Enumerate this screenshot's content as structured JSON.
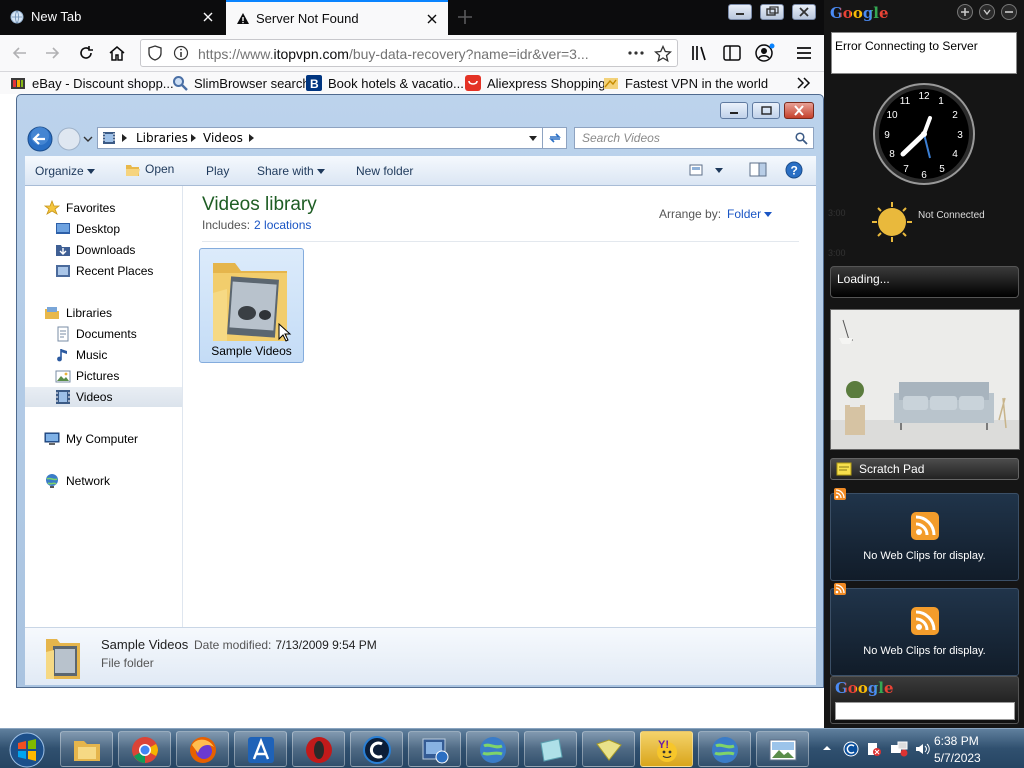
{
  "browser": {
    "tabs": [
      {
        "label": "New Tab",
        "active": false
      },
      {
        "label": "Server Not Found",
        "active": true
      }
    ],
    "url_prefix": "https://www.",
    "url_domain": "itopvpn.com",
    "url_path": "/buy-data-recovery?name=idr&ver=3...",
    "bookmarks": [
      {
        "label": "eBay - Discount shopp...",
        "icon": "ebay-icon"
      },
      {
        "label": "SlimBrowser search",
        "icon": "search-icon"
      },
      {
        "label": "Book hotels & vacatio...",
        "icon": "booking-icon"
      },
      {
        "label": "Aliexpress Shopping",
        "icon": "aliexpress-icon"
      },
      {
        "label": "Fastest VPN in the world",
        "icon": "vpn-icon"
      }
    ]
  },
  "explorer": {
    "breadcrumb": [
      "Libraries",
      "Videos"
    ],
    "search_placeholder": "Search Videos",
    "toolbar": {
      "organize": "Organize",
      "open": "Open",
      "play": "Play",
      "share_with": "Share with",
      "new_folder": "New folder"
    },
    "nav": {
      "favorites": "Favorites",
      "desktop": "Desktop",
      "downloads": "Downloads",
      "recent_places": "Recent Places",
      "libraries": "Libraries",
      "documents": "Documents",
      "music": "Music",
      "pictures": "Pictures",
      "videos": "Videos",
      "my_computer": "My Computer",
      "network": "Network"
    },
    "library_title": "Videos library",
    "includes_label": "Includes:",
    "includes_link": "2 locations",
    "arrange_label": "Arrange by:",
    "arrange_value": "Folder",
    "folder_name": "Sample Videos",
    "details": {
      "name": "Sample Videos",
      "modified_label": "Date modified:",
      "modified_value": "7/13/2009 9:54 PM",
      "type": "File folder"
    }
  },
  "sidebar": {
    "logo": "Google",
    "error_text": "Error Connecting to Server",
    "weather_status": "Not Connected",
    "ghost_times": [
      "3:00",
      "3:00"
    ],
    "loading_text": "Loading...",
    "scratch_pad": "Scratch Pad",
    "webclips_text": "No Web Clips for display.",
    "search_logo": "Google"
  },
  "taskbar": {
    "time": "6:38 PM",
    "date": "5/7/2023",
    "apps": [
      "explorer-icon",
      "chrome-icon",
      "firefox-icon",
      "acrobat-icon",
      "opera-icon",
      "ccleaner-icon",
      "remote-icon",
      "globe-icon",
      "notes-icon",
      "folder-icon",
      "yahoo-icon",
      "globe-icon",
      "image-icon"
    ]
  },
  "colors": {
    "accent_blue": "#0a84ff",
    "library_title_green": "#1e5d24",
    "link_blue": "#1a55c4",
    "sidebar_bg": "#151515"
  }
}
